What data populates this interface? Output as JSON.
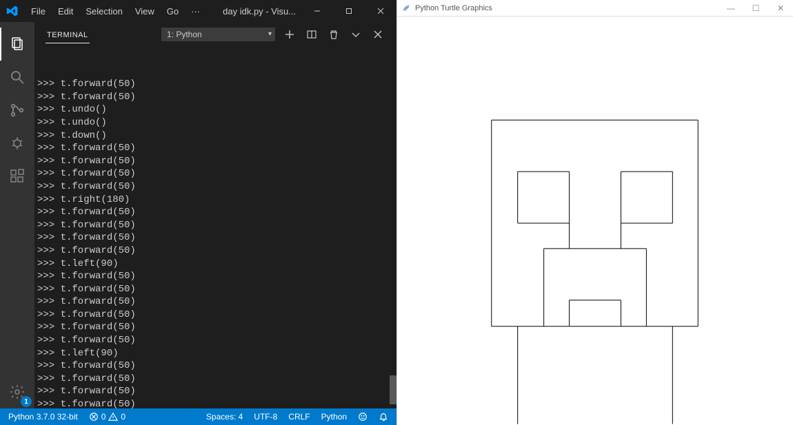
{
  "vscode": {
    "menus": [
      "File",
      "Edit",
      "Selection",
      "View",
      "Go",
      "···"
    ],
    "title": "day idk.py - Visu...",
    "activity_badge": "1",
    "panel": {
      "tab": "TERMINAL",
      "dropdown": "1: Python",
      "lines": [
        ">>> t.forward(50)",
        ">>> t.forward(50)",
        ">>> t.undo()",
        ">>> t.undo()",
        ">>> t.down()",
        ">>> t.forward(50)",
        ">>> t.forward(50)",
        ">>> t.forward(50)",
        ">>> t.forward(50)",
        ">>> t.right(180)",
        ">>> t.forward(50)",
        ">>> t.forward(50)",
        ">>> t.forward(50)",
        ">>> t.forward(50)",
        ">>> t.left(90)",
        ">>> t.forward(50)",
        ">>> t.forward(50)",
        ">>> t.forward(50)",
        ">>> t.forward(50)",
        ">>> t.forward(50)",
        ">>> t.forward(50)",
        ">>> t.left(90)",
        ">>> t.forward(50)",
        ">>> t.forward(50)",
        ">>> t.forward(50)",
        ">>> t.forward(50)"
      ],
      "prompt": ">>> "
    },
    "status": {
      "python": "Python 3.7.0 32-bit",
      "errors": "0",
      "warnings": "0",
      "spaces": "Spaces: 4",
      "encoding": "UTF-8",
      "eol": "CRLF",
      "lang": "Python"
    }
  },
  "turtle": {
    "title": "Python Turtle Graphics"
  }
}
